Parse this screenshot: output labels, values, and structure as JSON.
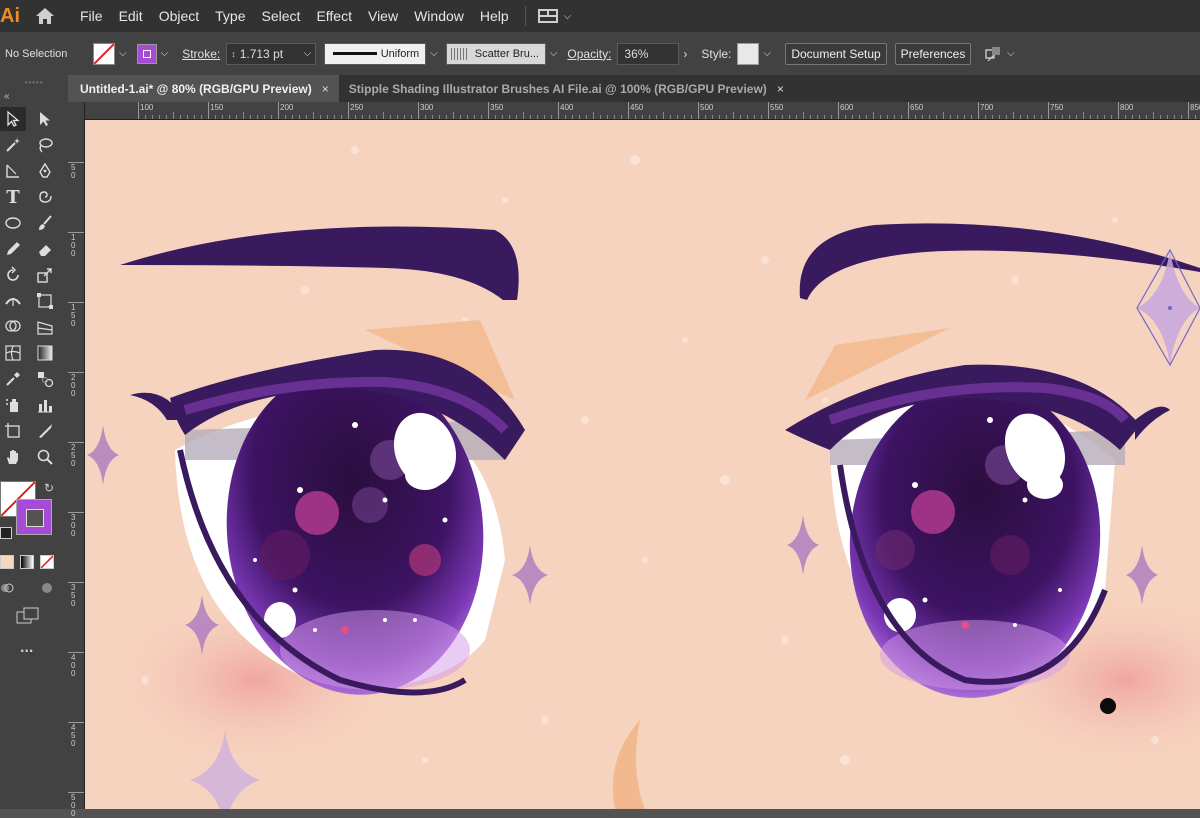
{
  "app": {
    "logo": "Ai"
  },
  "menu": [
    "File",
    "Edit",
    "Object",
    "Type",
    "Select",
    "Effect",
    "View",
    "Window",
    "Help"
  ],
  "control": {
    "selection": "No Selection",
    "stroke_label": "Stroke:",
    "stroke_value": "1.713 pt",
    "profile": "Uniform",
    "brush": "Scatter Bru...",
    "opacity_label": "Opacity:",
    "opacity_value": "36%",
    "style_label": "Style:",
    "document_setup": "Document Setup",
    "preferences": "Preferences"
  },
  "tabs": [
    {
      "label": "Untitled-1.ai* @ 80% (RGB/GPU Preview)",
      "close": "×"
    },
    {
      "label": "Stipple Shading Illustrator Brushes AI File.ai @ 100% (RGB/GPU Preview)",
      "close": "×"
    }
  ],
  "ruler_h": [
    "100",
    "150",
    "200",
    "250",
    "300",
    "350",
    "400",
    "450",
    "500",
    "550",
    "600",
    "650",
    "700",
    "750",
    "800",
    "850"
  ],
  "ruler_v": [
    "5 0",
    "1 0 0",
    "1 5 0",
    "2 0 0",
    "2 5 0",
    "3 0 0",
    "3 5 0",
    "4 0 0",
    "4 5 0",
    "5 0 0"
  ],
  "colors": {
    "fill": "#ffffff",
    "stroke": "#a64bd6",
    "skin": "#f6d3bf",
    "eye_dark": "#2a1140",
    "iris": "#4a1d78",
    "accent": "#f08a24"
  },
  "toolbar": {
    "more": "..."
  }
}
